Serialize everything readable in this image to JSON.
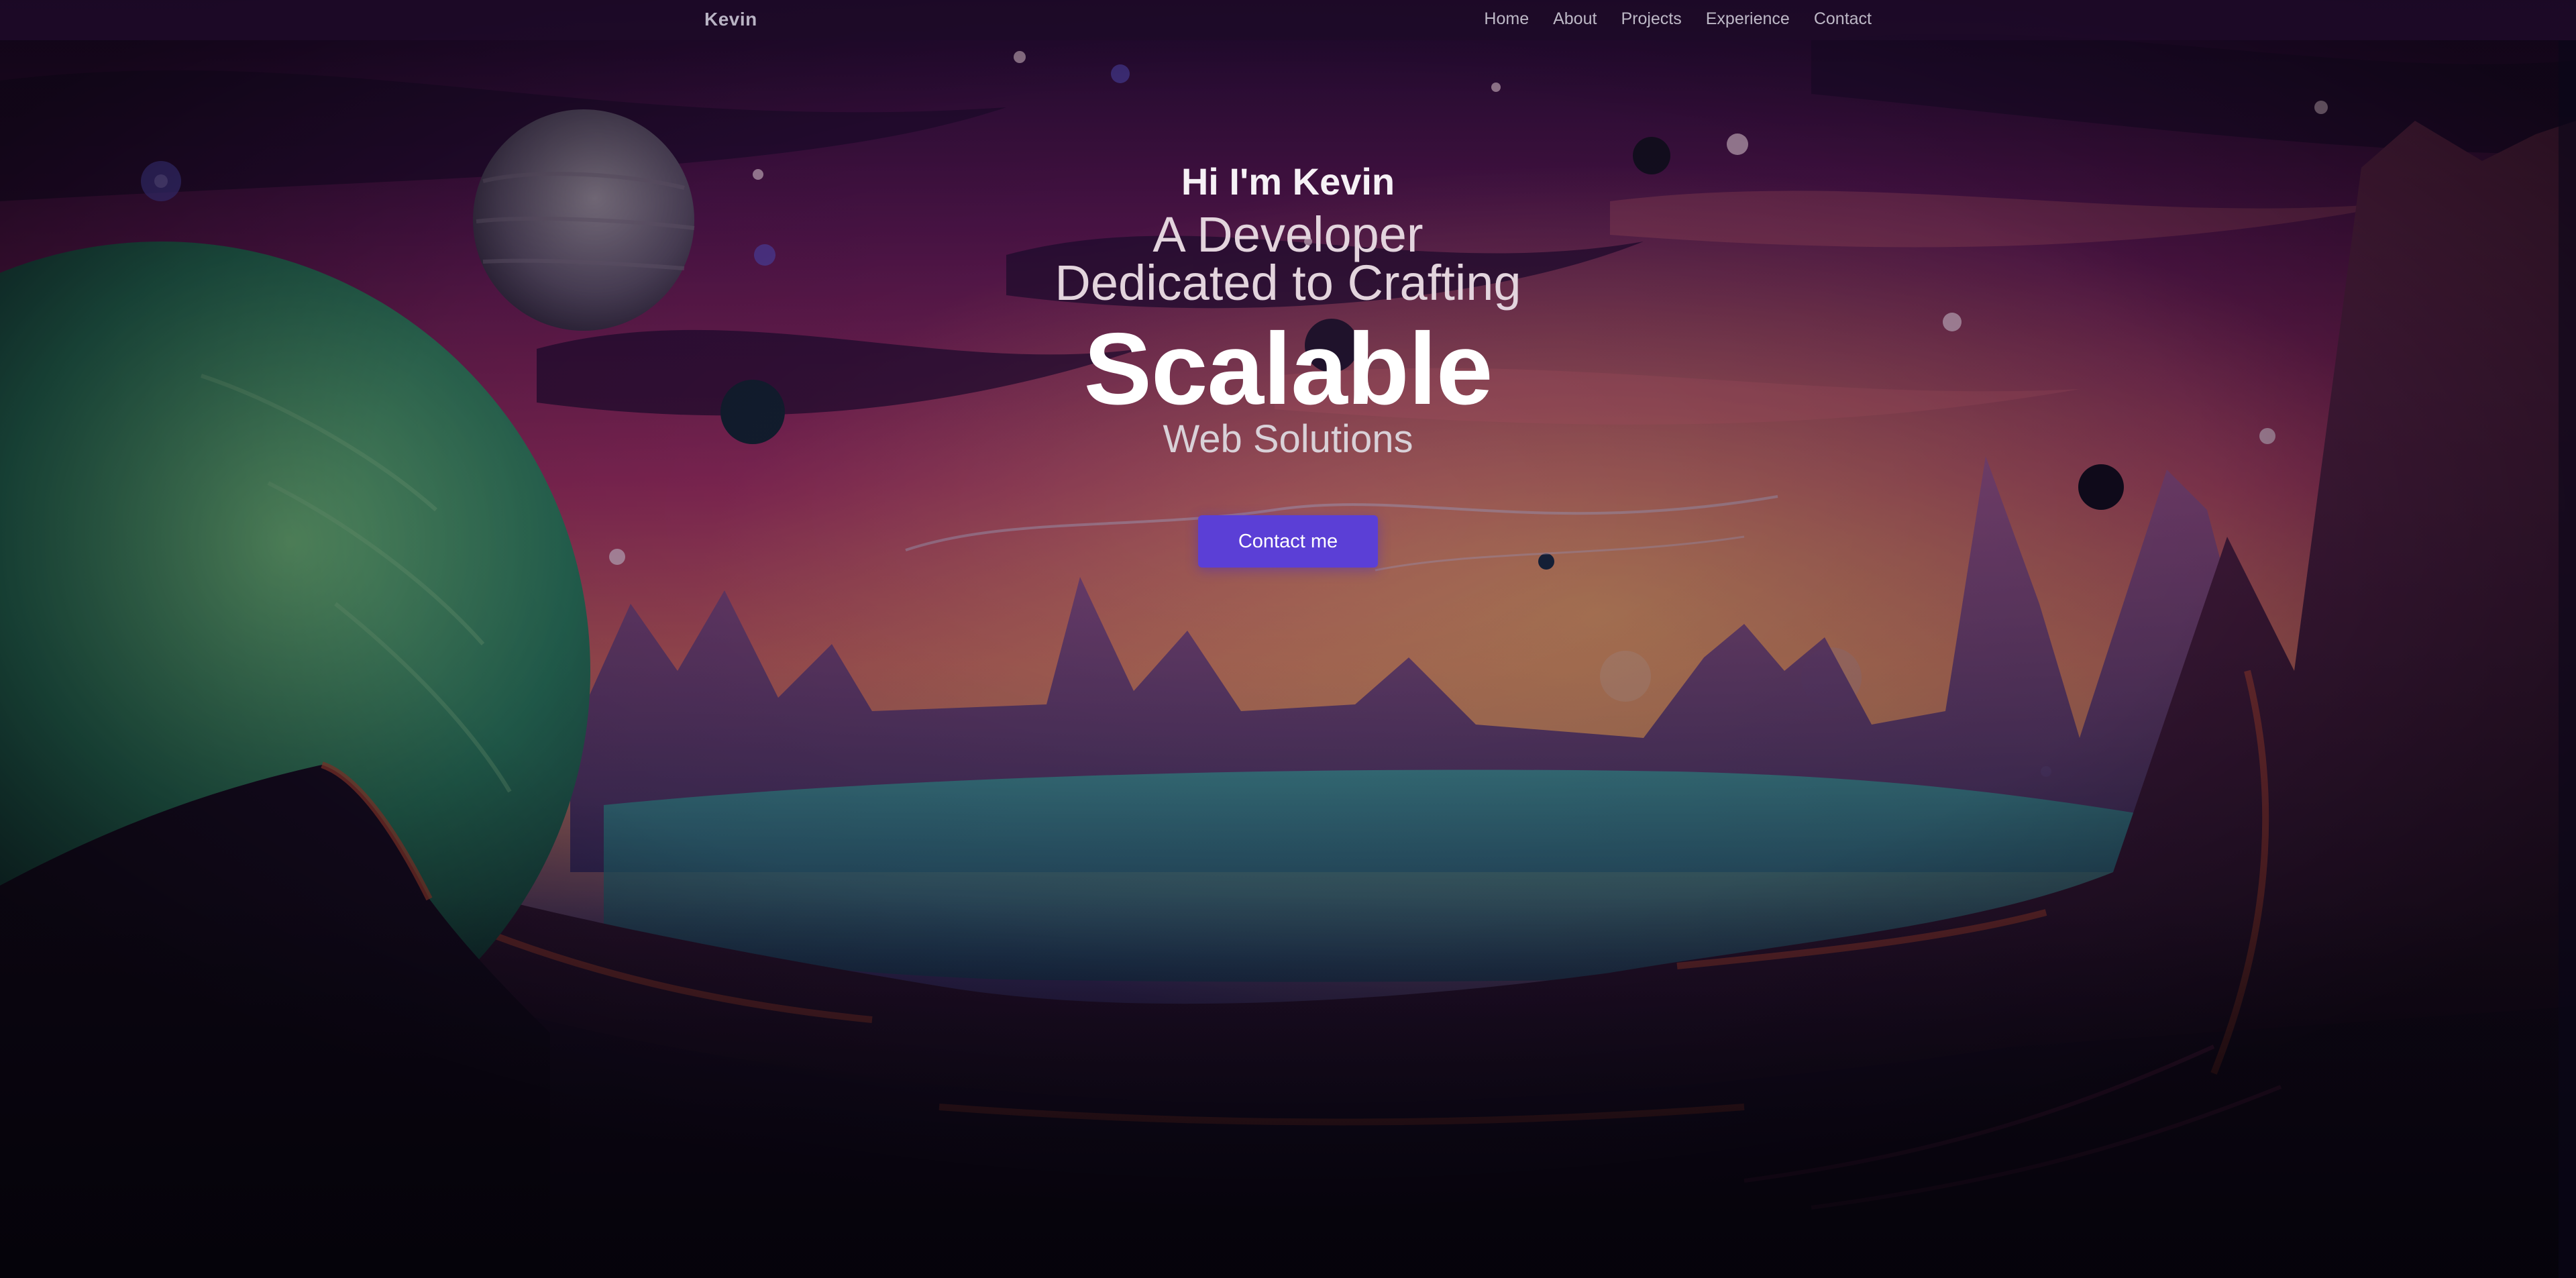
{
  "navbar": {
    "brand": "Kevin",
    "links": [
      "Home",
      "About",
      "Projects",
      "Experience",
      "Contact"
    ]
  },
  "hero": {
    "greeting": "Hi I'm Kevin",
    "line1": "A Developer",
    "line2": "Dedicated to Crafting",
    "highlight": "Scalable",
    "line3": "Web Solutions",
    "cta_label": "Contact me"
  },
  "colors": {
    "accent": "#5b3fd6",
    "navbar_bg": "#1e0a28",
    "sky_top": "#3a1150",
    "sky_mid": "#c43a6e",
    "sky_horizon": "#e8925a"
  }
}
